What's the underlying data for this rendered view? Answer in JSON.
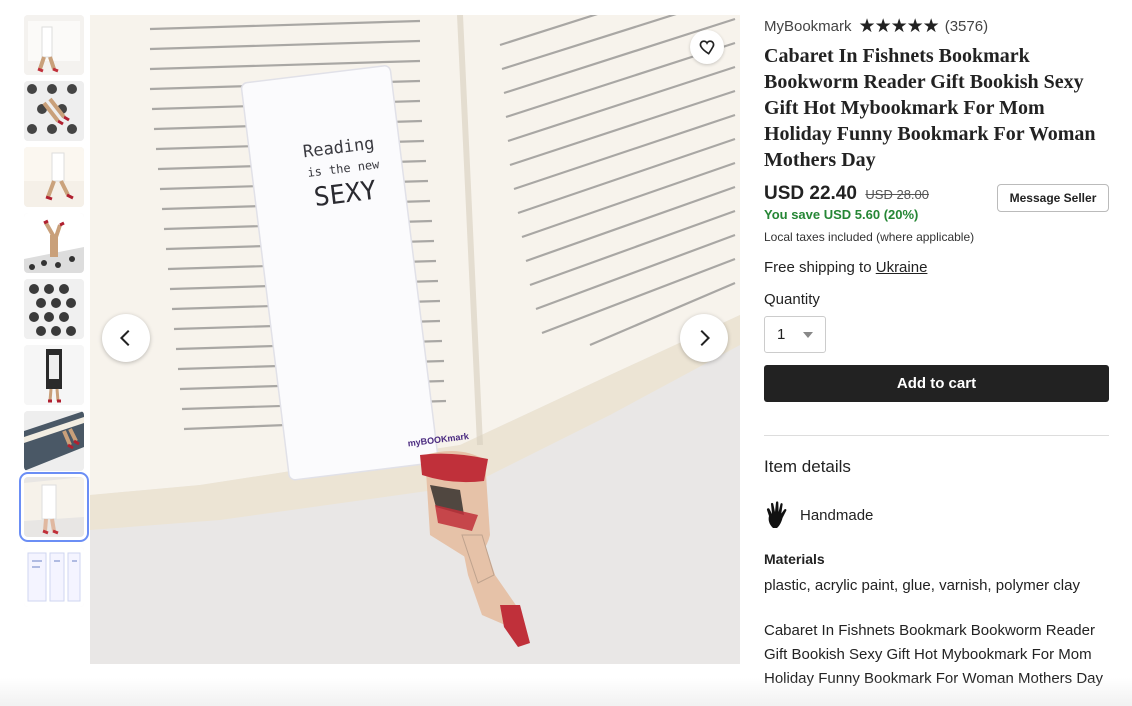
{
  "thumbnails": [
    {
      "label": "thumb-1"
    },
    {
      "label": "thumb-2"
    },
    {
      "label": "thumb-3"
    },
    {
      "label": "thumb-4"
    },
    {
      "label": "thumb-5"
    },
    {
      "label": "thumb-6"
    },
    {
      "label": "thumb-7"
    },
    {
      "label": "thumb-8",
      "selected": true
    },
    {
      "label": "thumb-9"
    }
  ],
  "main_image": {
    "bookmark_text_line1": "Reading",
    "bookmark_text_line2": "is the new",
    "bookmark_text_line3": "SEXY",
    "bookmark_brand": "myBOOKmark"
  },
  "product": {
    "shop_name": "MyBookmark",
    "stars": "★★★★★",
    "review_count": "(3576)",
    "title": "Cabaret In Fishnets Bookmark Bookworm Reader Gift Bookish Sexy Gift Hot Mybookmark For Mom Holiday Funny Bookmark For Woman Mothers Day",
    "price": "USD 22.40",
    "old_price": "USD 28.00",
    "savings": "You save USD 5.60 (20%)",
    "message_seller": "Message Seller",
    "taxes": "Local taxes included (where applicable)",
    "shipping_prefix": "Free shipping to ",
    "shipping_country": "Ukraine",
    "quantity_label": "Quantity",
    "quantity_value": "1",
    "add_to_cart": "Add to cart"
  },
  "details": {
    "heading": "Item details",
    "handmade": "Handmade",
    "materials_heading": "Materials",
    "materials": "plastic, acrylic paint, glue, varnish, polymer clay",
    "description": "Cabaret In Fishnets Bookmark Bookworm Reader Gift Bookish Sexy Gift Hot Mybookmark For Mom Holiday Funny Bookmark For Woman Mothers Day"
  },
  "colors": {
    "accent_dark": "#222222",
    "savings_green": "#258635",
    "selected_outline": "#6b8ef5"
  },
  "icons": [
    "heart-icon",
    "chevron-left-icon",
    "chevron-right-icon",
    "hand-icon",
    "caret-down-icon"
  ]
}
